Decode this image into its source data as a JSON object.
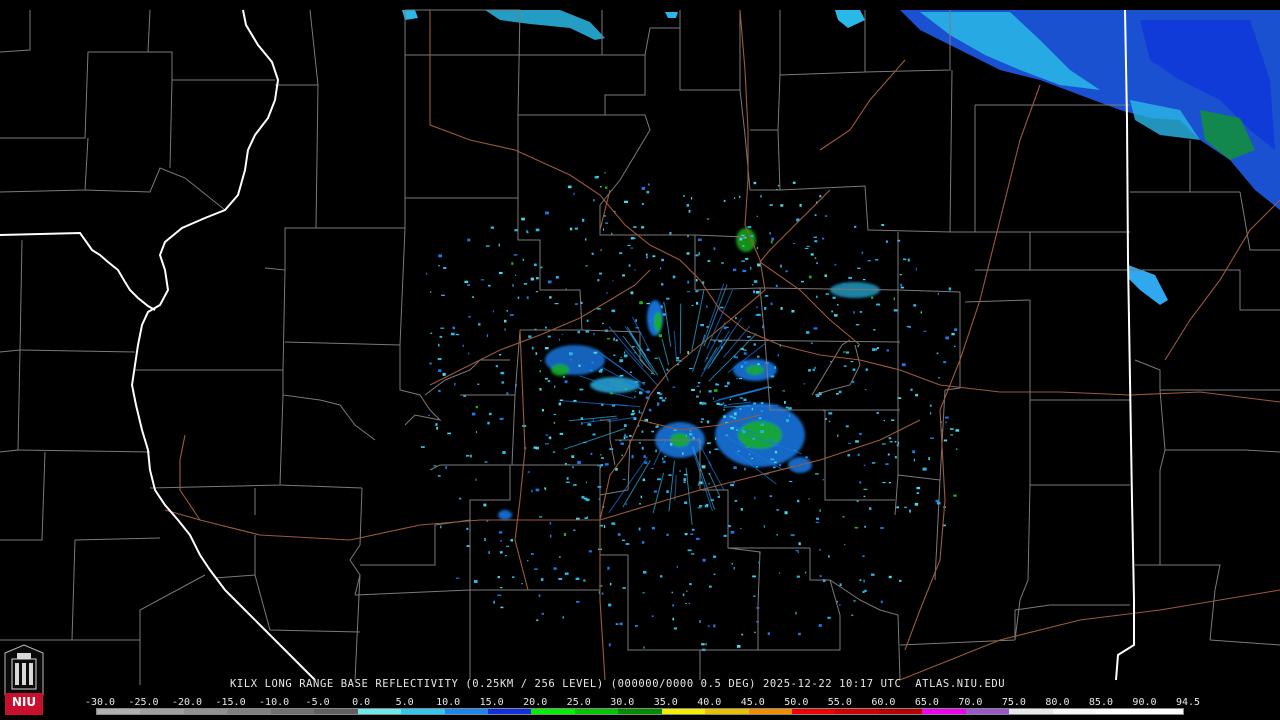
{
  "caption": "KILX LONG RANGE BASE REFLECTIVITY (0.25KM / 256 LEVEL) (000000/0000 0.5 DEG) 2025-12-22 10:17 UTC  ATLAS.NIU.EDU",
  "legend": {
    "labels": [
      "-30.0",
      "-25.0",
      "-20.0",
      "-15.0",
      "-10.0",
      "-5.0",
      "0.0",
      "5.0",
      "10.0",
      "15.0",
      "20.0",
      "25.0",
      "30.0",
      "35.0",
      "40.0",
      "45.0",
      "50.0",
      "55.0",
      "60.0",
      "65.0",
      "70.0",
      "75.0",
      "80.0",
      "85.0",
      "90.0",
      "94.5"
    ],
    "colors": [
      "#b0b0b0",
      "#a0a0a0",
      "#909090",
      "#808080",
      "#707070",
      "#606060",
      "#6ee8e8",
      "#30c8f0",
      "#1888f0",
      "#1030e0",
      "#00f000",
      "#00c800",
      "#008c00",
      "#f0f000",
      "#e8c000",
      "#f08c00",
      "#f00000",
      "#d00000",
      "#b40000",
      "#f000f0",
      "#9858c8",
      "#e8e8e8",
      "#f8f8f8",
      "#ffffff",
      "#ffffff"
    ]
  },
  "logo": {
    "text": "NIU"
  },
  "colors": {
    "background": "#000000",
    "county_lines": "#7a7a7a",
    "state_lines": "#ffffff",
    "roads": "#9c5a3c"
  }
}
